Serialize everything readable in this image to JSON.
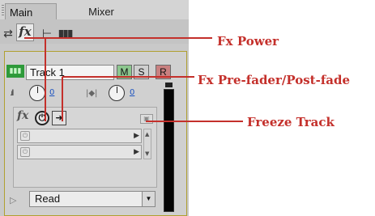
{
  "tabs": [
    {
      "label": "Main",
      "active": true
    },
    {
      "label": "Mixer",
      "active": false
    }
  ],
  "toolbar": {
    "routing_icon": "routing-arrows-icon",
    "fx_label": "fx",
    "eq_icon": "eq-icon",
    "mixer_icon": "mixer-bars-icon"
  },
  "track": {
    "name": "Track 1",
    "color": "#2e9a3a",
    "mute_label": "M",
    "solo_label": "S",
    "record_label": "R",
    "volume_value": "0",
    "pan_value": "0",
    "fx_label": "fx",
    "automation_mode": "Read"
  },
  "callouts": {
    "fx_power": "Fx Power",
    "fx_prepost": "Fx Pre-fader/Post-fade",
    "freeze": "Freeze Track"
  },
  "colors": {
    "callout": "#c4302b",
    "mute": "#8cc78e",
    "record": "#c98080"
  }
}
